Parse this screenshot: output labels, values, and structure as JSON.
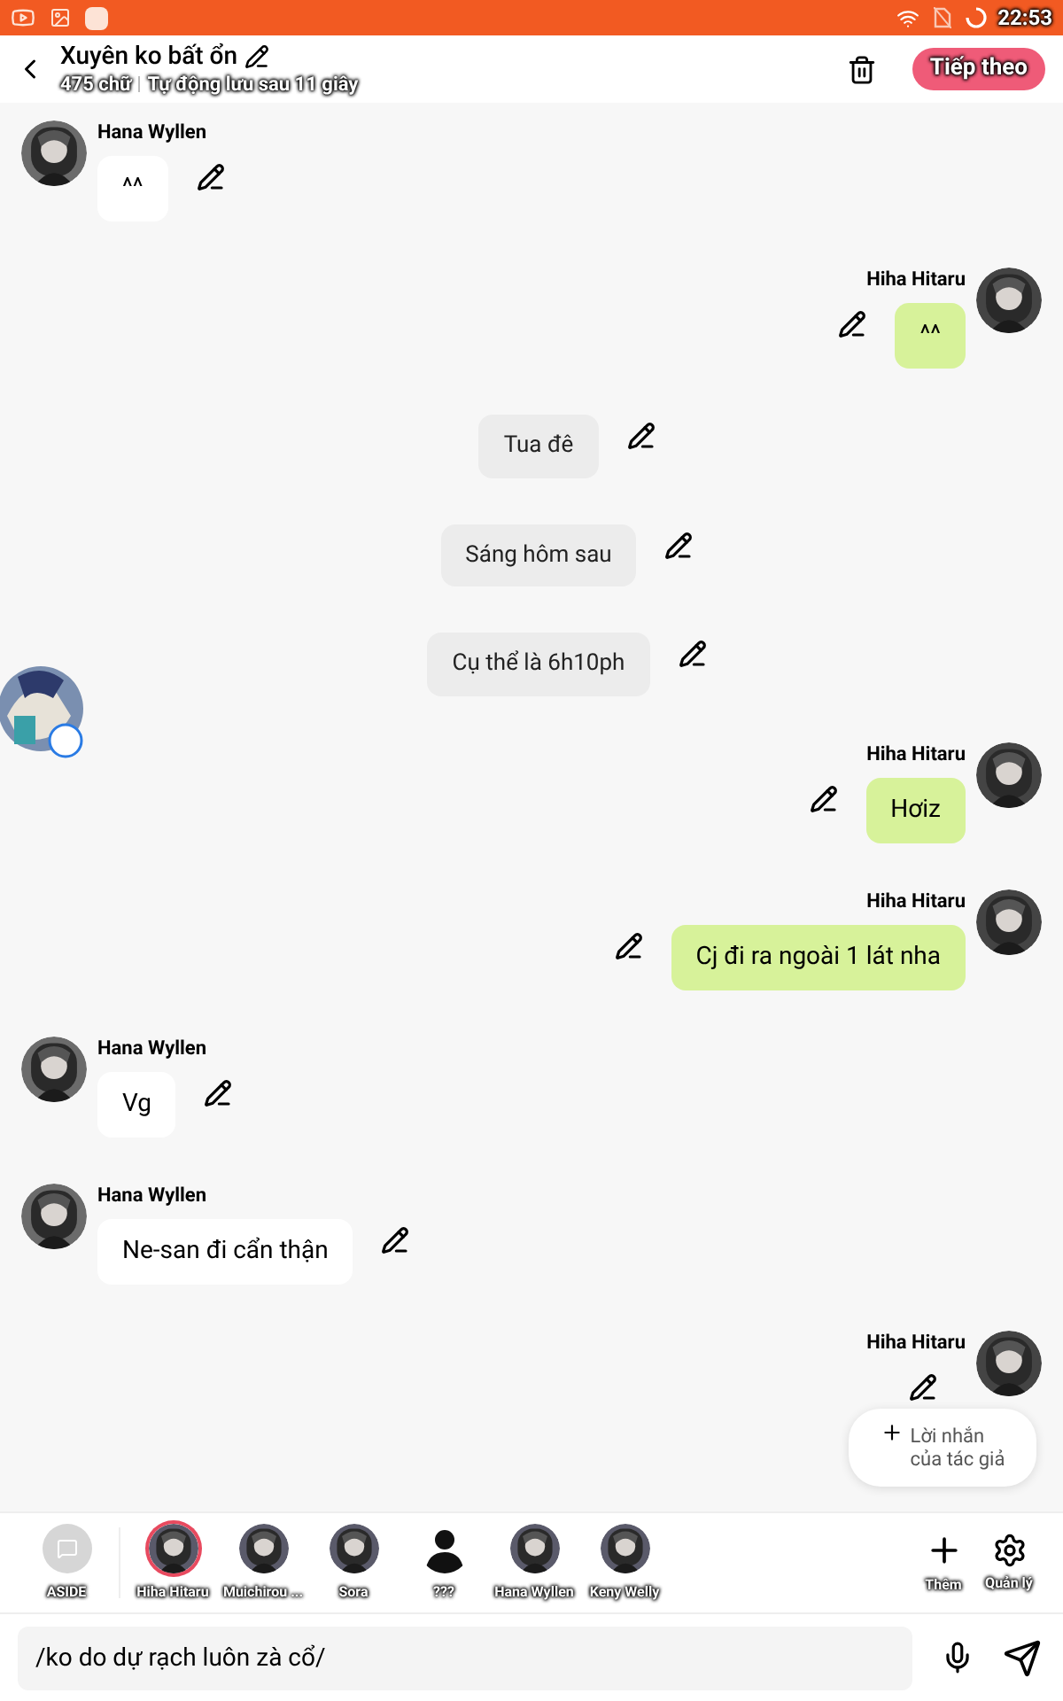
{
  "status_bar": {
    "time": "22:53"
  },
  "header": {
    "title": "Xuyên ko bất ổn",
    "word_count": "475 chữ",
    "autosave": "Tự động lưu sau 11 giây",
    "next_button": "Tiếp theo"
  },
  "messages": [
    {
      "kind": "left",
      "name": "Hana Wyllen",
      "text": "^^"
    },
    {
      "kind": "right",
      "name": "Hiha Hitaru",
      "text": "^^"
    },
    {
      "kind": "narration",
      "text": "Tua đê"
    },
    {
      "kind": "narration",
      "text": "Sáng hôm sau"
    },
    {
      "kind": "narration",
      "text": "Cụ thể là 6h10ph"
    },
    {
      "kind": "right",
      "name": "Hiha Hitaru",
      "text": "Hơiz"
    },
    {
      "kind": "right",
      "name": "Hiha Hitaru",
      "text": "Cj đi ra ngoài 1 lát nha"
    },
    {
      "kind": "left",
      "name": "Hana Wyllen",
      "text": "Vg"
    },
    {
      "kind": "left",
      "name": "Hana Wyllen",
      "text": "Ne-san đi cẩn thận"
    },
    {
      "kind": "right",
      "name": "Hiha Hitaru"
    }
  ],
  "author_note_button": "Lời nhắn\ncủa tác giả",
  "characters": [
    {
      "kind": "aside",
      "name": "ASIDE",
      "selected": false
    },
    {
      "kind": "avatar",
      "name": "Hiha Hitaru",
      "selected": true
    },
    {
      "kind": "avatar",
      "name": "Muichirou ...",
      "selected": false
    },
    {
      "kind": "avatar",
      "name": "Sora",
      "selected": false
    },
    {
      "kind": "silhouette",
      "name": "???",
      "selected": false
    },
    {
      "kind": "avatar",
      "name": "Hana Wyllen",
      "selected": false
    },
    {
      "kind": "avatar",
      "name": "Keny Welly",
      "selected": false
    }
  ],
  "character_actions": [
    {
      "kind": "add",
      "label": "Thêm"
    },
    {
      "kind": "manage",
      "label": "Quản lý"
    }
  ],
  "composer": {
    "value": "/ko do dự rạch luôn zà cổ/"
  }
}
